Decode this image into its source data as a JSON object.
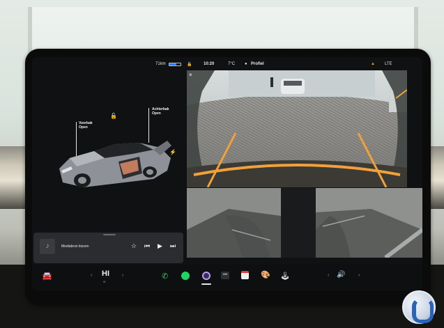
{
  "statusbar": {
    "range": "71km",
    "time": "10:20",
    "temperature": "7°C",
    "profile": "Profiel",
    "warning_icon": "warning-icon",
    "lte": "LTE"
  },
  "car": {
    "front_trunk_label": "Voorbak\nOpen",
    "rear_trunk_label": "Achterbak\nOpen",
    "lock_icon": "unlock-icon",
    "charge_icon": "lightning-icon"
  },
  "media": {
    "source_label": "Mediabron kiezen",
    "icons": [
      "music-note-icon",
      "star-icon",
      "previous-icon",
      "play-icon",
      "next-icon"
    ]
  },
  "dock": {
    "climate_label": "HI",
    "icons": [
      "car-icon",
      "phone-icon",
      "spotify-icon",
      "camera-icon",
      "more-icon",
      "calendar-icon",
      "toybox-icon",
      "joystick-icon",
      "volume-icon"
    ]
  },
  "camera": {
    "close_label": "×"
  },
  "colors": {
    "screen_bg": "#101113",
    "phone_green": "#3ecb5a",
    "spotify_green": "#1ed760",
    "camera_purple": "#b99ef2",
    "calendar_red": "#e03e36",
    "guide_orange": "#f2a13a"
  }
}
